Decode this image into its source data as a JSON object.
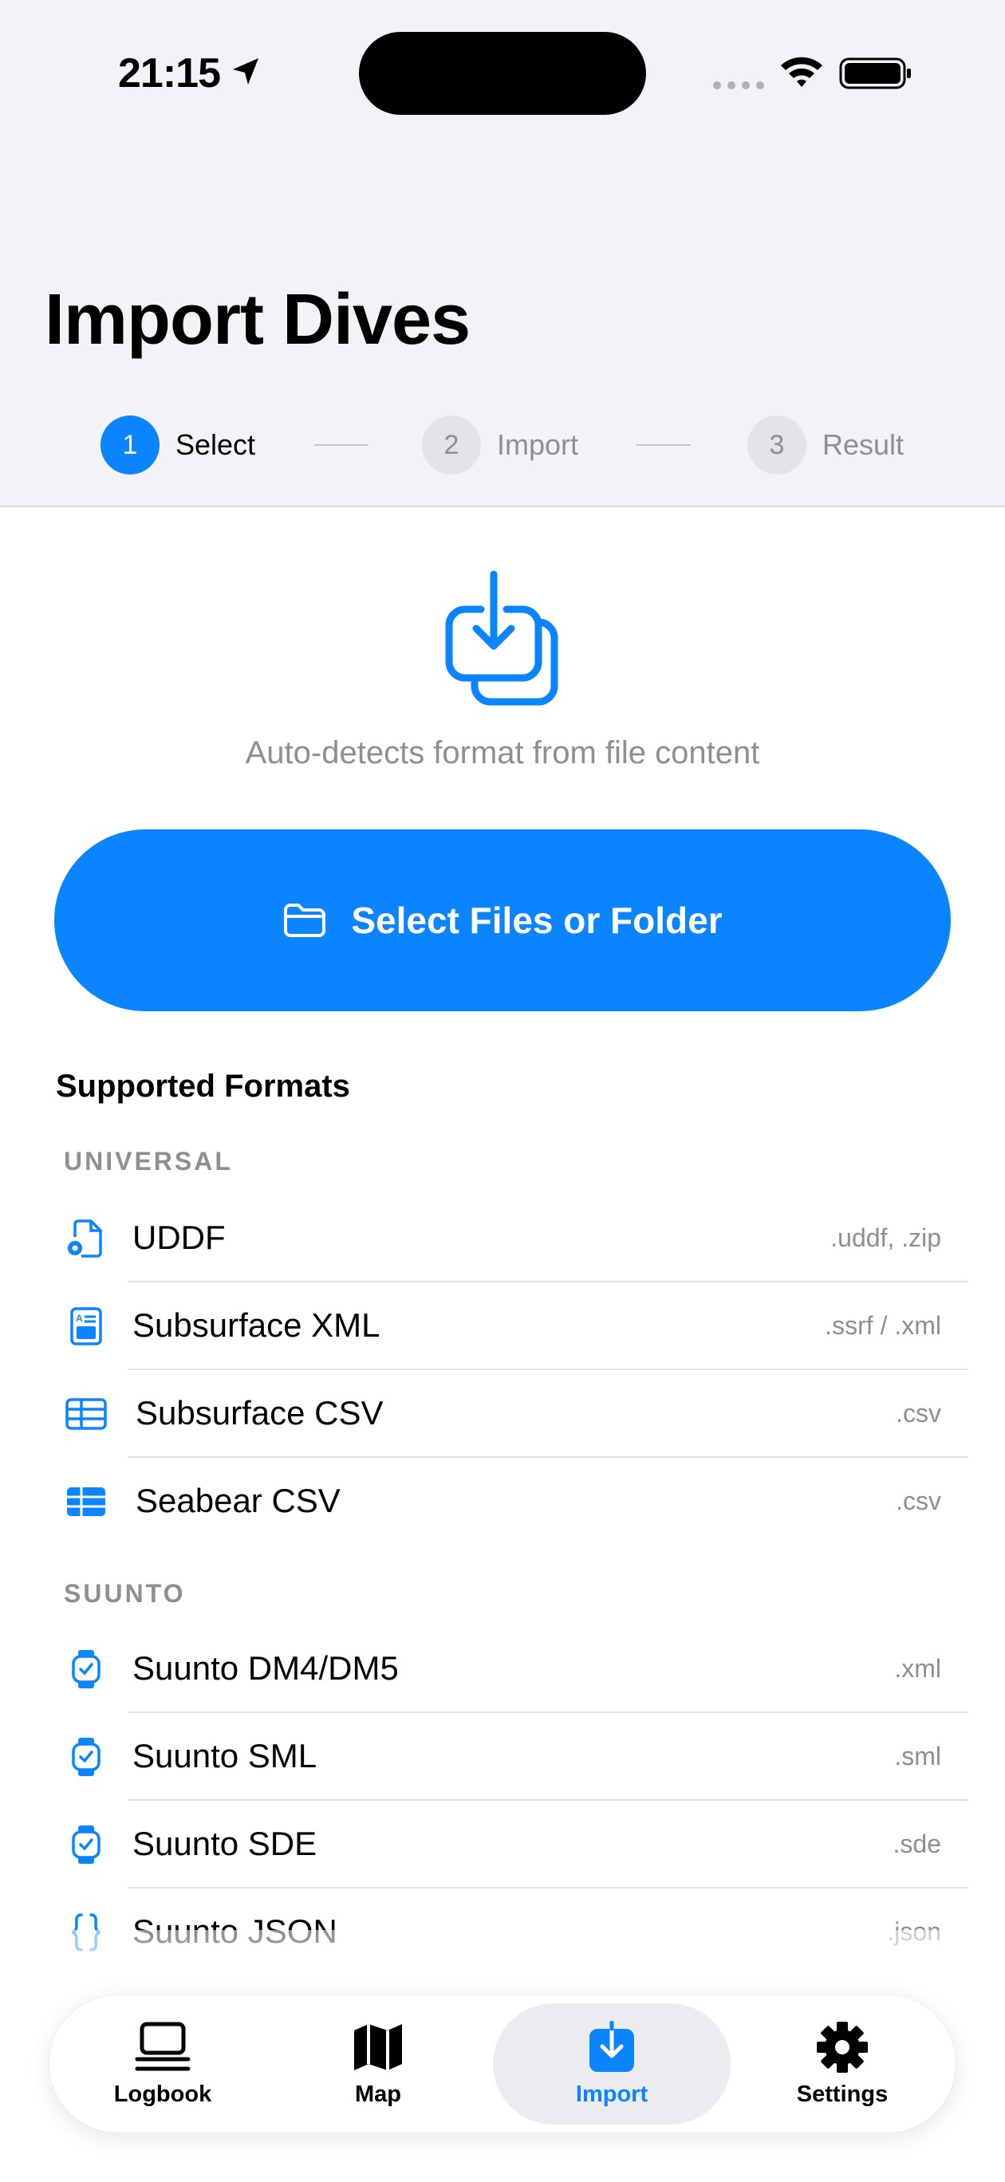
{
  "status_bar": {
    "time": "21:15"
  },
  "page": {
    "title": "Import Dives"
  },
  "stepper": {
    "steps": [
      {
        "number": "1",
        "label": "Select"
      },
      {
        "number": "2",
        "label": "Import"
      },
      {
        "number": "3",
        "label": "Result"
      }
    ],
    "active_step": 1
  },
  "hero": {
    "icon": "square-and-arrow-down-on-square-icon",
    "caption": "Auto-detects format from file content"
  },
  "select_button": {
    "label": "Select Files or Folder",
    "icon": "folder-icon"
  },
  "supported": {
    "heading": "Supported Formats",
    "groups": [
      {
        "label": "UNIVERSAL",
        "formats": [
          {
            "name": "UDDF",
            "ext": ".uddf, .zip",
            "icon": "doc-gear-icon"
          },
          {
            "name": "Subsurface XML",
            "ext": ".ssrf / .xml",
            "icon": "doc-richtext-icon"
          },
          {
            "name": "Subsurface CSV",
            "ext": ".csv",
            "icon": "table-icon"
          },
          {
            "name": "Seabear CSV",
            "ext": ".csv",
            "icon": "table-filled-icon"
          }
        ]
      },
      {
        "label": "SUUNTO",
        "formats": [
          {
            "name": "Suunto DM4/DM5",
            "ext": ".xml",
            "icon": "watch-icon"
          },
          {
            "name": "Suunto SML",
            "ext": ".sml",
            "icon": "watch-icon"
          },
          {
            "name": "Suunto SDE",
            "ext": ".sde",
            "icon": "watch-icon"
          },
          {
            "name": "Suunto JSON",
            "ext": ".json",
            "icon": "curly-braces-icon"
          }
        ]
      }
    ]
  },
  "tabbar": {
    "tabs": [
      {
        "label": "Logbook",
        "icon": "logbook-icon"
      },
      {
        "label": "Map",
        "icon": "map-icon"
      },
      {
        "label": "Import",
        "icon": "import-icon"
      },
      {
        "label": "Settings",
        "icon": "gear-icon"
      }
    ],
    "active_tab": "Import"
  },
  "colors": {
    "accent": "#0a84ff",
    "secondary_text": "#8e8e93",
    "header_bg": "#f2f2f7"
  }
}
